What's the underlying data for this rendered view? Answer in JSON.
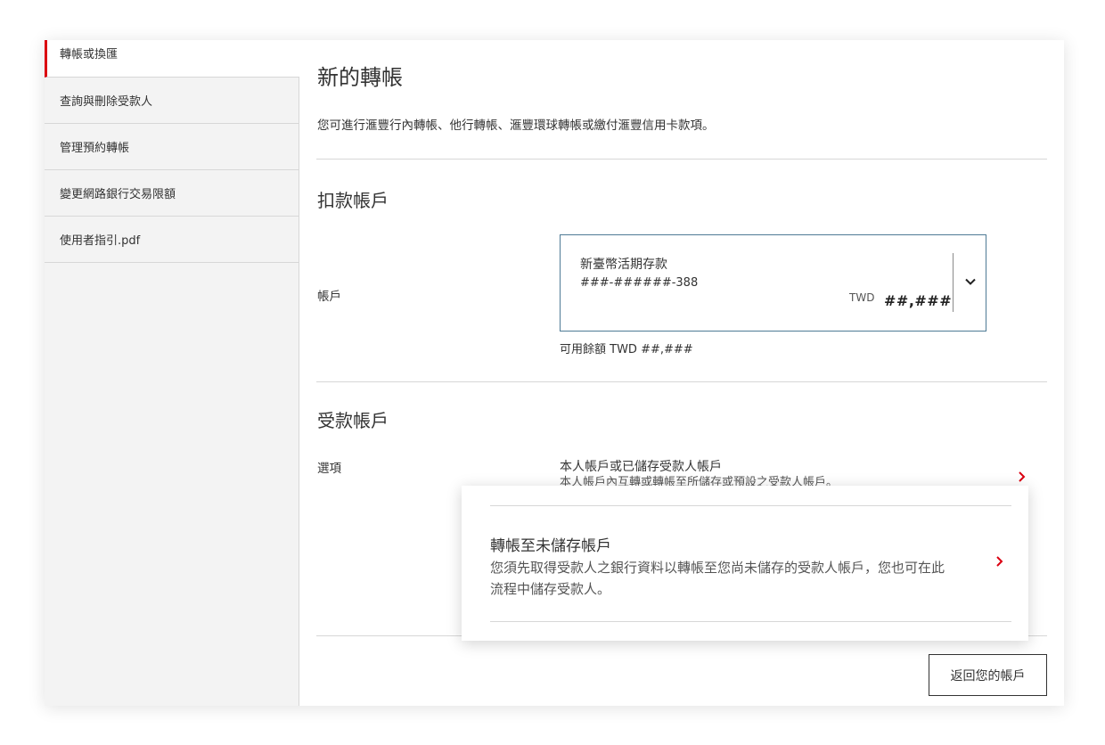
{
  "sidebar": {
    "items": [
      {
        "label": "轉帳或換匯"
      },
      {
        "label": "查詢與刪除受款人"
      },
      {
        "label": "管理預約轉帳"
      },
      {
        "label": "變更網路銀行交易限額"
      },
      {
        "label": "使用者指引.pdf"
      }
    ]
  },
  "main": {
    "title": "新的轉帳",
    "intro": "您可進行滙豐行內轉帳、他行轉帳、滙豐環球轉帳或繳付滙豐信用卡款項。",
    "debit": {
      "heading": "扣款帳戶",
      "account_label": "帳戶",
      "account": {
        "name": "新臺幣活期存款",
        "number": "###-######-388",
        "currency": "TWD",
        "balance": "##,###"
      },
      "available": "可用餘額 TWD ##,###"
    },
    "payee": {
      "heading": "受款帳戶",
      "options_label": "選項",
      "option1": {
        "title": "本人帳戶或已儲存受款人帳戶",
        "desc": "本人帳戶內互轉或轉帳至所儲存或預設之受款人帳戶。"
      },
      "option2": {
        "title": "轉帳至未儲存帳戶",
        "desc": "您須先取得受款人之銀行資料以轉帳至您尚未儲存的受款人帳戶，您也可在此流程中儲存受款人。"
      }
    },
    "back_button": "返回您的帳戶"
  },
  "colors": {
    "accent_red": "#db0011",
    "select_border": "#4e7a95",
    "divider": "#d7d7d7"
  },
  "icons": {
    "select_chevron": "chevron-down-icon",
    "option_chevron": "chevron-right-icon"
  }
}
